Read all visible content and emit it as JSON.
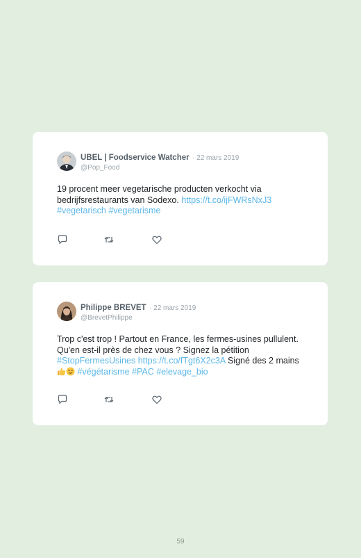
{
  "tweets": [
    {
      "author": "UBEL | Foodservice Watcher",
      "date": "· 22 mars 2019",
      "handle": "@Pop_Food",
      "text_1": "19 procent meer vegetarische producten verkocht via bedrijfsrestaurants van Sodexo. ",
      "link": "https://t.co/ijFWRsNxJ3",
      "hashtag_1": "#vegetarisch",
      "hashtag_2": "#vegetarisme"
    },
    {
      "author": "Philippe BREVET",
      "date": "· 22 mars 2019",
      "handle": "@BrevetPhilippe",
      "text_1": "Trop c'est trop ! Partout en France, les fermes-usines pullulent. Qu'en est-il près de chez vous ? Signez la pétition ",
      "hashtag_1": "#StopFermesUsines",
      "link": "https://t.co/fTgt6X2c3A",
      "text_2": " Signé des 2 mains ",
      "hashtag_2": "#végétarisme",
      "hashtag_3": "#PAC",
      "hashtag_4": "#elevage_bio"
    }
  ],
  "icons": [
    "reply-icon",
    "retweet-icon",
    "like-icon",
    "thumbs-up-emoji",
    "winking-face-emoji"
  ],
  "page_number": "59"
}
